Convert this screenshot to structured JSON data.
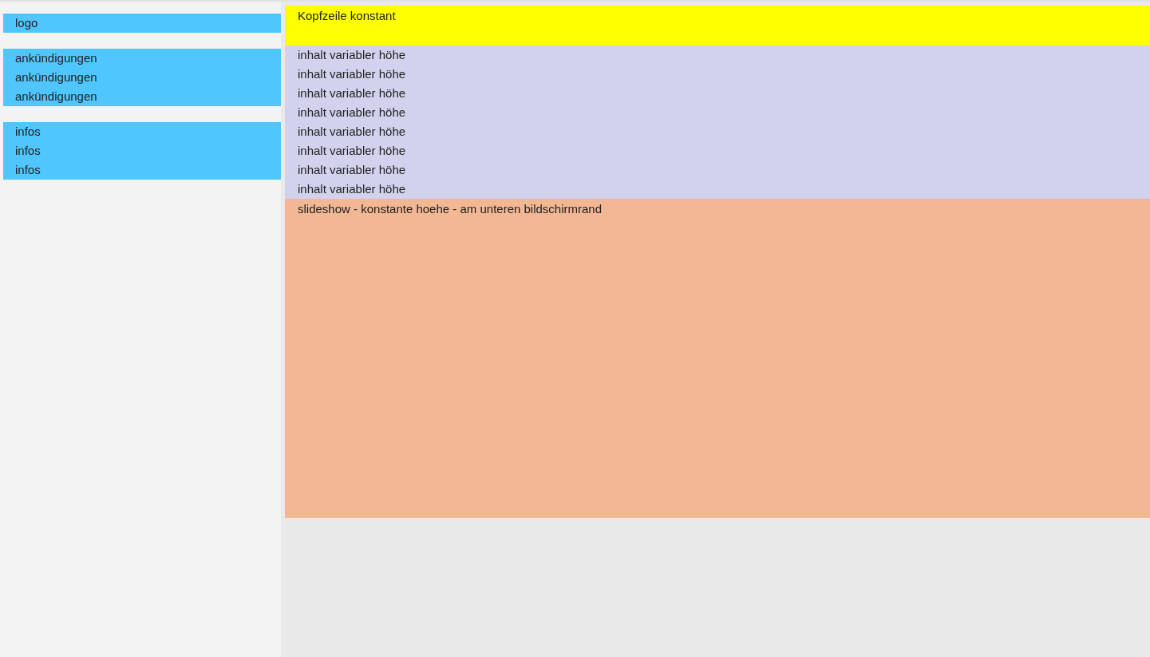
{
  "sidebar": {
    "logo": "logo",
    "announcements": [
      "ankündigungen",
      "ankündigungen",
      "ankündigungen"
    ],
    "infos": [
      "infos",
      "infos",
      "infos"
    ]
  },
  "header": {
    "title": "Kopfzeile konstant"
  },
  "content": {
    "lines": [
      "inhalt variabler höhe",
      "inhalt variabler höhe",
      "inhalt variabler höhe",
      "inhalt variabler höhe",
      "inhalt variabler höhe",
      "inhalt variabler höhe",
      "inhalt variabler höhe",
      "inhalt variabler höhe"
    ]
  },
  "slideshow": {
    "label": "slideshow - konstante hoehe - am unteren bildschirmrand"
  }
}
